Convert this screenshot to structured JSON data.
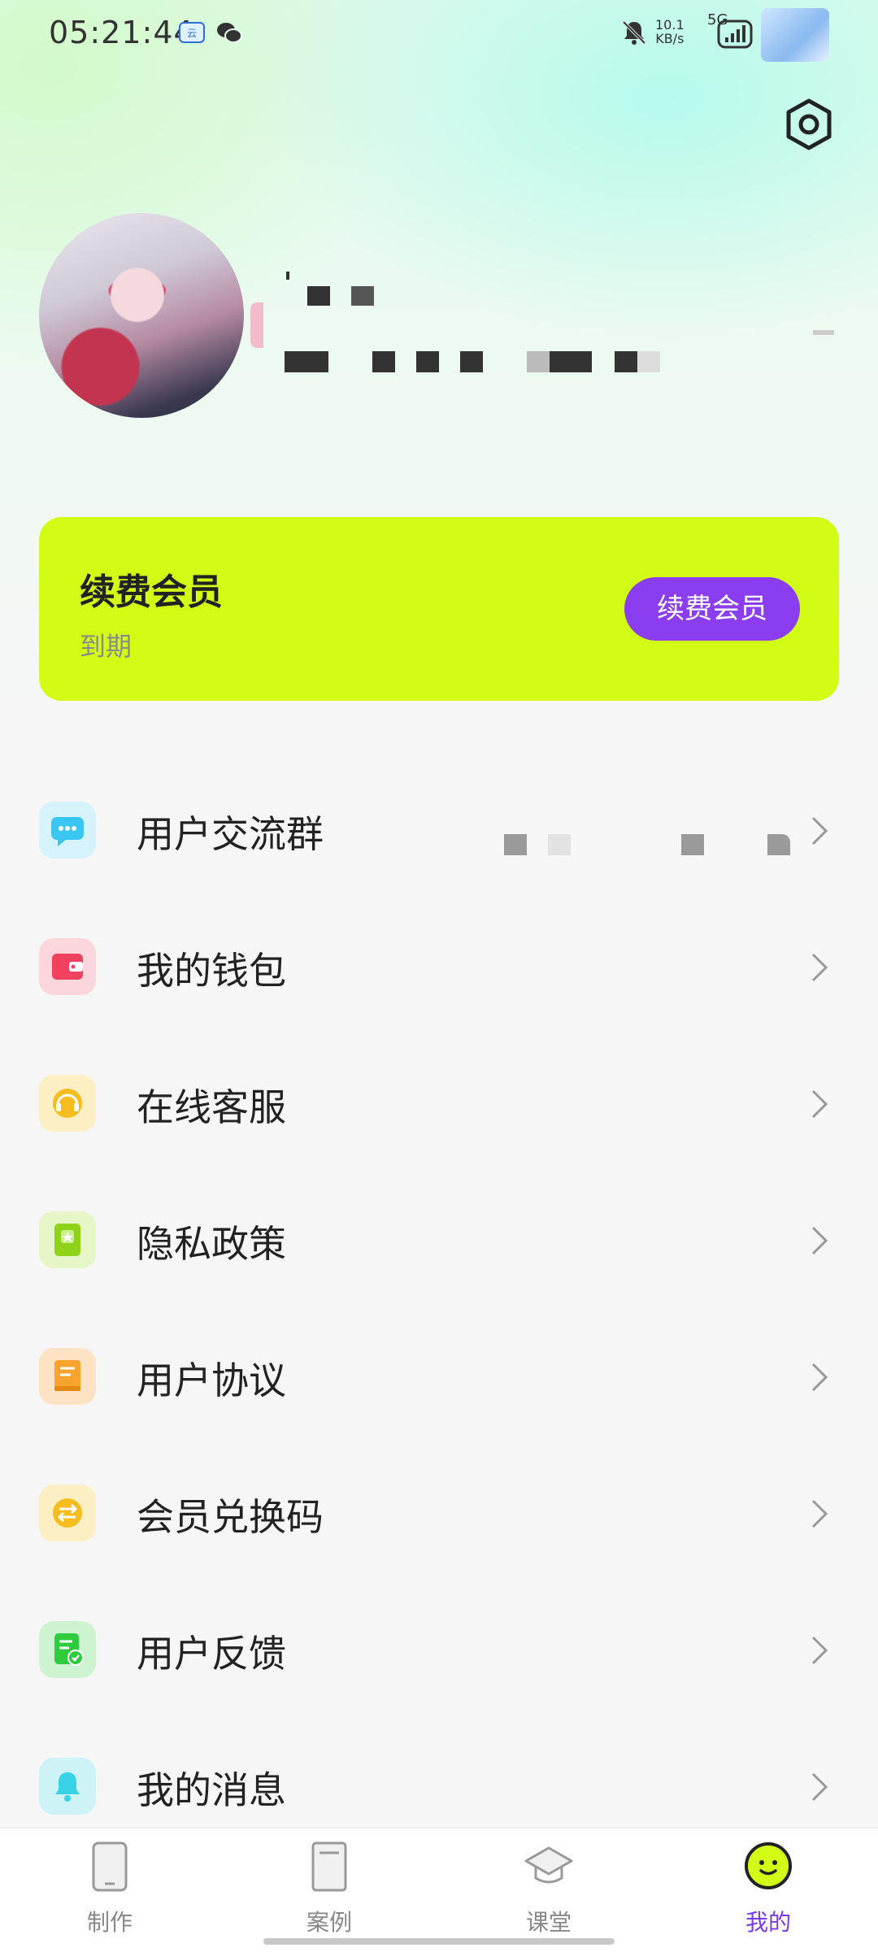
{
  "status_bar": {
    "time": "05:21:44",
    "net_speed_value": "10.1",
    "net_speed_unit": "KB/s",
    "network_type": "5G"
  },
  "profile": {
    "avatar_name": "avatar"
  },
  "vip": {
    "title": "续费会员",
    "subtitle": "到期",
    "button_label": "续费会员",
    "bg_color": "#d2fb15",
    "button_color": "#8b3df0"
  },
  "menu": {
    "items": [
      {
        "label": "用户交流群",
        "icon": "chat-icon",
        "color": "#39c6f2"
      },
      {
        "label": "我的钱包",
        "icon": "wallet-icon",
        "color": "#f0425f"
      },
      {
        "label": "在线客服",
        "icon": "headset-icon",
        "color": "#f7bd1e"
      },
      {
        "label": "隐私政策",
        "icon": "privacy-icon",
        "color": "#8fd21a"
      },
      {
        "label": "用户协议",
        "icon": "agreement-icon",
        "color": "#f7a32e"
      },
      {
        "label": "会员兑换码",
        "icon": "exchange-icon",
        "color": "#f7bd1e"
      },
      {
        "label": "用户反馈",
        "icon": "feedback-icon",
        "color": "#2ecb3f"
      },
      {
        "label": "我的消息",
        "icon": "bell-icon",
        "color": "#38d3e6"
      }
    ]
  },
  "tabbar": {
    "tabs": [
      {
        "label": "制作",
        "icon": "phone-icon",
        "active": false
      },
      {
        "label": "案例",
        "icon": "document-icon",
        "active": false
      },
      {
        "label": "课堂",
        "icon": "graduation-cap-icon",
        "active": false
      },
      {
        "label": "我的",
        "icon": "smiley-icon",
        "active": true
      }
    ],
    "active_color": "#7b3ae6"
  }
}
